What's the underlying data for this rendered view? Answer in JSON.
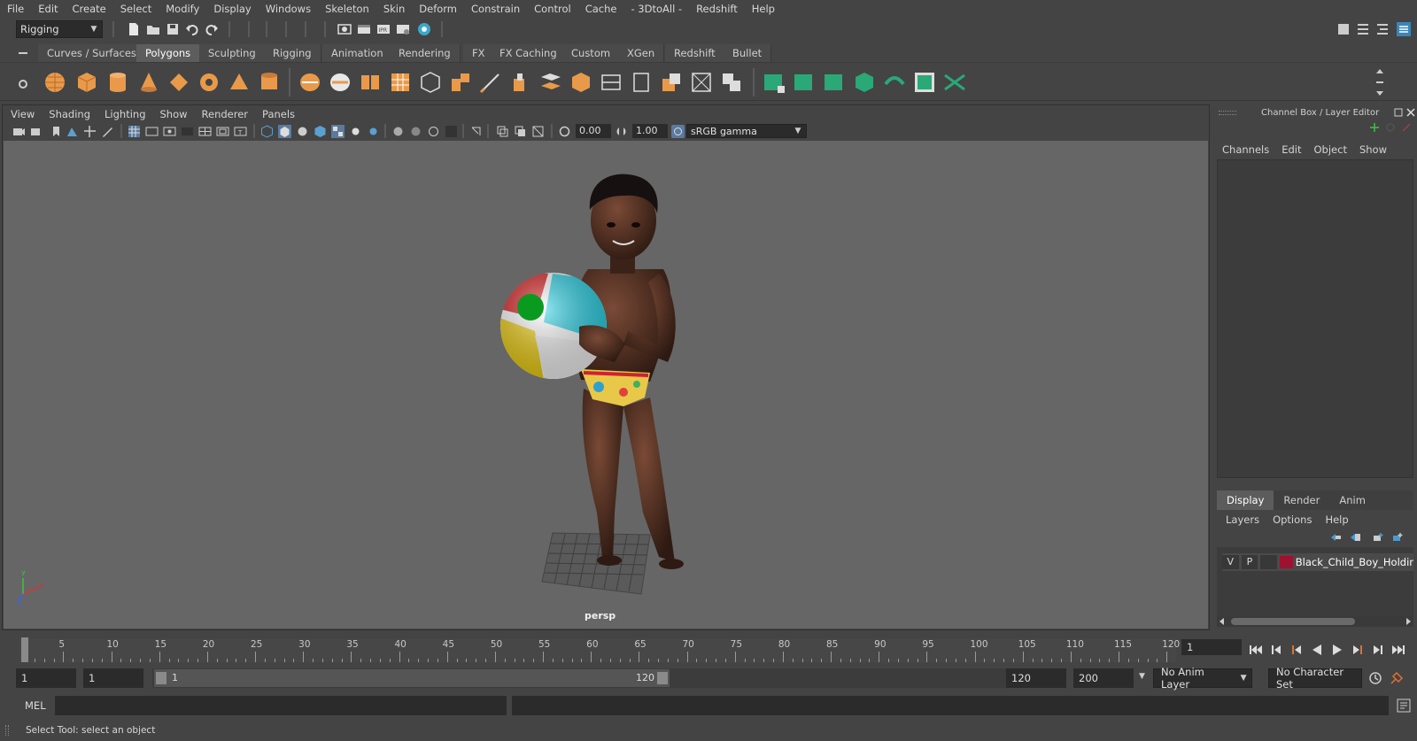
{
  "menubar": {
    "items": [
      "File",
      "Edit",
      "Create",
      "Select",
      "Modify",
      "Display",
      "Windows",
      "Skeleton",
      "Skin",
      "Deform",
      "Constrain",
      "Control",
      "Cache",
      "- 3DtoAll -",
      "Redshift",
      "Help"
    ]
  },
  "statusline": {
    "menuset": "Rigging"
  },
  "shelf": {
    "tabs": [
      "Curves / Surfaces",
      "Polygons",
      "Sculpting",
      "Rigging",
      "Animation",
      "Rendering",
      "FX",
      "FX Caching",
      "Custom",
      "XGen",
      "Redshift",
      "Bullet"
    ],
    "active_tab": "Polygons"
  },
  "viewport": {
    "menu": [
      "View",
      "Shading",
      "Lighting",
      "Show",
      "Renderer",
      "Panels"
    ],
    "exposure": "0.00",
    "gamma": "1.00",
    "color_space": "sRGB gamma",
    "camera_label": "persp",
    "axis_labels": {
      "x": "x",
      "y": "y",
      "z": "z"
    }
  },
  "channel_box": {
    "title": "Channel Box / Layer Editor",
    "menu": [
      "Channels",
      "Edit",
      "Object",
      "Show"
    ]
  },
  "layer_editor": {
    "tabs": [
      "Display",
      "Render",
      "Anim"
    ],
    "active_tab": "Display",
    "menu": [
      "Layers",
      "Options",
      "Help"
    ],
    "layer": {
      "visible": "V",
      "playback": "P",
      "name": "Black_Child_Boy_Holding"
    }
  },
  "timeline": {
    "labels": [
      "1",
      "5",
      "10",
      "15",
      "20",
      "25",
      "30",
      "35",
      "40",
      "45",
      "50",
      "55",
      "60",
      "65",
      "70",
      "75",
      "80",
      "85",
      "90",
      "95",
      "100",
      "105",
      "110",
      "115",
      "120"
    ],
    "current_frame": "1"
  },
  "range": {
    "start": "1",
    "playback_start": "1",
    "slider_start": "1",
    "slider_end": "120",
    "playback_end": "120",
    "end": "200",
    "anim_layer": "No Anim Layer",
    "character_set": "No Character Set"
  },
  "command_line": {
    "language": "MEL"
  },
  "help_line": {
    "text": "Select Tool: select an object"
  }
}
